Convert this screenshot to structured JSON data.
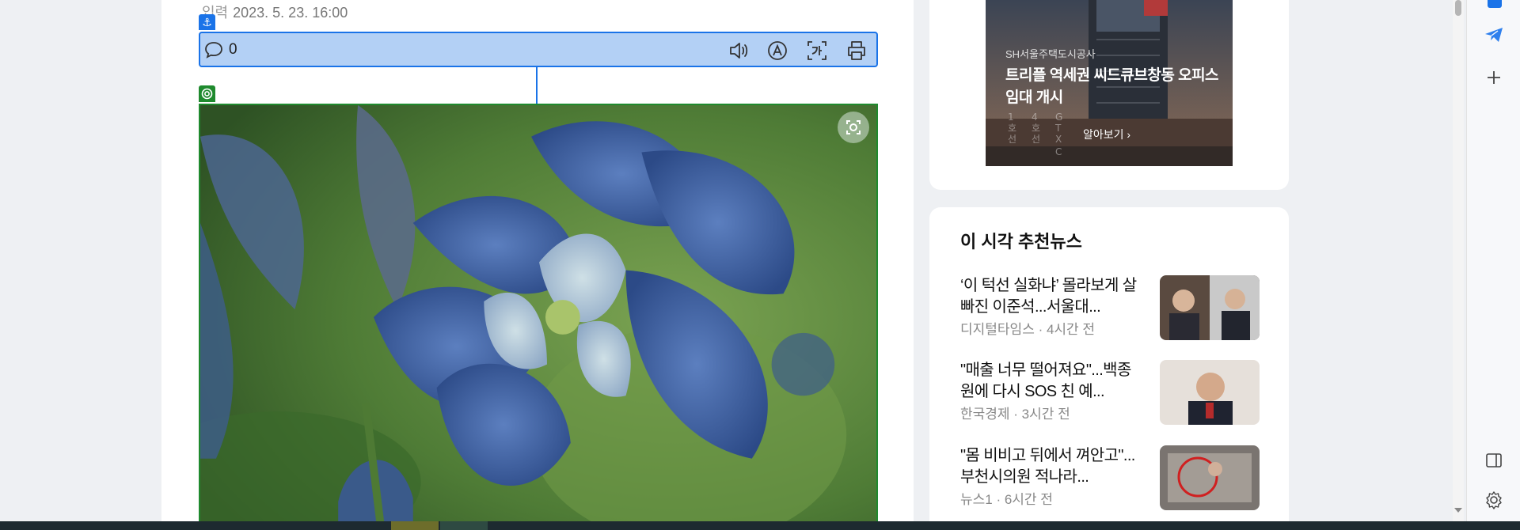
{
  "article": {
    "timestamp_label": "입력",
    "timestamp_value": "2023. 5. 23. 16:00",
    "comment_count": "0",
    "photo_subject": "blue columbine flower photograph"
  },
  "toolbar": {
    "icons": [
      "speech-bubble-icon",
      "speaker-icon",
      "text-size-icon",
      "translate-icon",
      "print-icon"
    ]
  },
  "ad": {
    "sponsor": "SH서울주택도시공사",
    "headline": "트리플 역세권 씨드큐브창동 오피스 임대 개시",
    "cta": "알아보기 ›",
    "sign_texts": [
      "1\n호\n선",
      "4\n호\n선",
      "G\nT\nX\nC"
    ]
  },
  "news": {
    "title": "이 시각 추천뉴스",
    "items": [
      {
        "headline": "‘이 턱선 실화냐’ 몰라보게 살 빠진 이준석...서울대...",
        "meta": "디지털타임스 · 4시간 전"
      },
      {
        "headline": "\"매출 너무 떨어져요\"...백종원에 다시 SOS 친 예...",
        "meta": "한국경제 · 3시간 전"
      },
      {
        "headline": "\"몸 비비고 뒤에서 껴안고\"...부천시의원 적나라...",
        "meta": "뉴스1 · 6시간 전"
      }
    ]
  },
  "colors": {
    "toolbar_fill": "#b3d0f5",
    "toolbar_border": "#1a73e8",
    "photo_border": "#1f8a2e"
  },
  "side_panel": {
    "icons": [
      "outlook-icon",
      "telegram-icon",
      "add-icon",
      "sidebar-toggle-icon",
      "settings-gear-icon"
    ]
  }
}
